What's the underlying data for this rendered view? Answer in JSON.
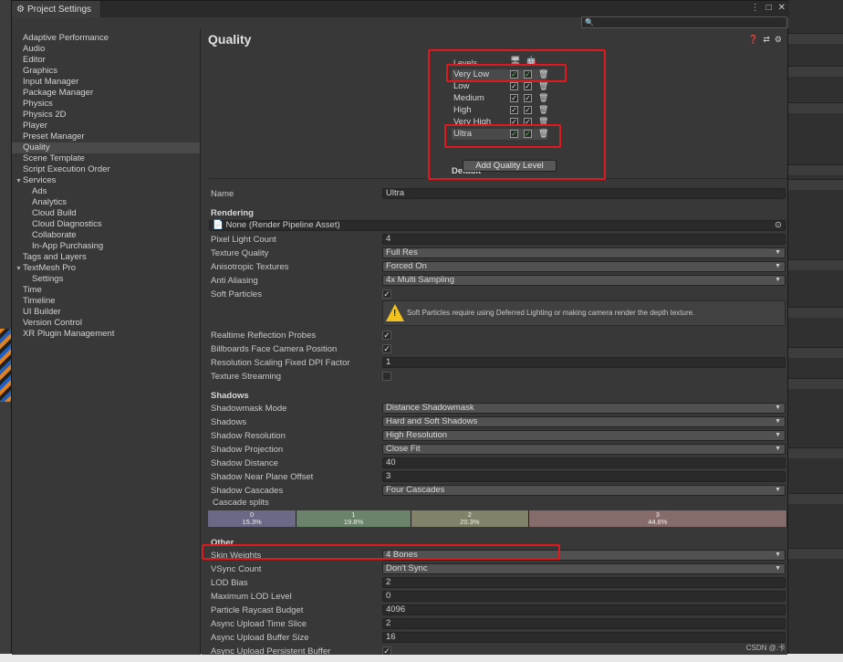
{
  "window": {
    "tab_title": "Project Settings",
    "search_placeholder": "",
    "search_icon": "search-icon"
  },
  "sidebar": {
    "items": [
      {
        "label": "Adaptive Performance",
        "child": false
      },
      {
        "label": "Audio",
        "child": false
      },
      {
        "label": "Editor",
        "child": false
      },
      {
        "label": "Graphics",
        "child": false
      },
      {
        "label": "Input Manager",
        "child": false
      },
      {
        "label": "Package Manager",
        "child": false
      },
      {
        "label": "Physics",
        "child": false
      },
      {
        "label": "Physics 2D",
        "child": false
      },
      {
        "label": "Player",
        "child": false
      },
      {
        "label": "Preset Manager",
        "child": false
      },
      {
        "label": "Quality",
        "child": false,
        "selected": true
      },
      {
        "label": "Scene Template",
        "child": false
      },
      {
        "label": "Script Execution Order",
        "child": false
      },
      {
        "label": "Services",
        "child": false,
        "foldout": true
      },
      {
        "label": "Ads",
        "child": true
      },
      {
        "label": "Analytics",
        "child": true
      },
      {
        "label": "Cloud Build",
        "child": true
      },
      {
        "label": "Cloud Diagnostics",
        "child": true
      },
      {
        "label": "Collaborate",
        "child": true
      },
      {
        "label": "In-App Purchasing",
        "child": true
      },
      {
        "label": "Tags and Layers",
        "child": false
      },
      {
        "label": "TextMesh Pro",
        "child": false,
        "foldout": true
      },
      {
        "label": "Settings",
        "child": true
      },
      {
        "label": "Time",
        "child": false
      },
      {
        "label": "Timeline",
        "child": false
      },
      {
        "label": "UI Builder",
        "child": false
      },
      {
        "label": "Version Control",
        "child": false
      },
      {
        "label": "XR Plugin Management",
        "child": false
      }
    ]
  },
  "header": {
    "title": "Quality"
  },
  "levels": {
    "heading": "Levels",
    "rows": [
      "Very Low",
      "Low",
      "Medium",
      "High",
      "Very High",
      "Ultra"
    ],
    "default_label": "Default",
    "add_button": "Add Quality Level"
  },
  "props": {
    "name_label": "Name",
    "name_value": "Ultra",
    "rendering_header": "Rendering",
    "pipeline_value": "None (Render Pipeline Asset)",
    "pixel_light_count_label": "Pixel Light Count",
    "pixel_light_count_value": "4",
    "texture_quality_label": "Texture Quality",
    "texture_quality_value": "Full Res",
    "anisotropic_label": "Anisotropic Textures",
    "anisotropic_value": "Forced On",
    "anti_aliasing_label": "Anti Aliasing",
    "anti_aliasing_value": "4x Multi Sampling",
    "soft_particles_label": "Soft Particles",
    "soft_particles_warning": "Soft Particles require using Deferred Lighting or making camera render the depth texture.",
    "realtime_reflection_label": "Realtime Reflection Probes",
    "billboards_label": "Billboards Face Camera Position",
    "res_scaling_label": "Resolution Scaling Fixed DPI Factor",
    "res_scaling_value": "1",
    "texture_streaming_label": "Texture Streaming",
    "shadows_header": "Shadows",
    "shadowmask_label": "Shadowmask Mode",
    "shadowmask_value": "Distance Shadowmask",
    "shadows_label": "Shadows",
    "shadows_value": "Hard and Soft Shadows",
    "shadow_res_label": "Shadow Resolution",
    "shadow_res_value": "High Resolution",
    "shadow_proj_label": "Shadow Projection",
    "shadow_proj_value": "Close Fit",
    "shadow_dist_label": "Shadow Distance",
    "shadow_dist_value": "40",
    "shadow_near_label": "Shadow Near Plane Offset",
    "shadow_near_value": "3",
    "shadow_cascades_label": "Shadow Cascades",
    "shadow_cascades_value": "Four Cascades",
    "cascade_splits_label": "Cascade splits",
    "other_header": "Other",
    "skin_weights_label": "Skin Weights",
    "skin_weights_value": "4 Bones",
    "vsync_label": "VSync Count",
    "vsync_value": "Don't Sync",
    "lod_bias_label": "LOD Bias",
    "lod_bias_value": "2",
    "max_lod_label": "Maximum LOD Level",
    "max_lod_value": "0",
    "raycast_label": "Particle Raycast Budget",
    "raycast_value": "4096",
    "async_slice_label": "Async Upload Time Slice",
    "async_slice_value": "2",
    "async_buffer_label": "Async Upload Buffer Size",
    "async_buffer_value": "16",
    "async_persistent_label": "Async Upload Persistent Buffer"
  },
  "cascade_splits": [
    {
      "index": "0",
      "percent": "15.3%",
      "fraction": 0.153,
      "color": "#6a6a86"
    },
    {
      "index": "1",
      "percent": "19.8%",
      "fraction": 0.198,
      "color": "#6b826b"
    },
    {
      "index": "2",
      "percent": "20.3%",
      "fraction": 0.203,
      "color": "#82826a"
    },
    {
      "index": "3",
      "percent": "44.6%",
      "fraction": 0.446,
      "color": "#866b6b"
    }
  ],
  "watermark": "CSDN @.卡",
  "highlight_color": "#e0191f"
}
